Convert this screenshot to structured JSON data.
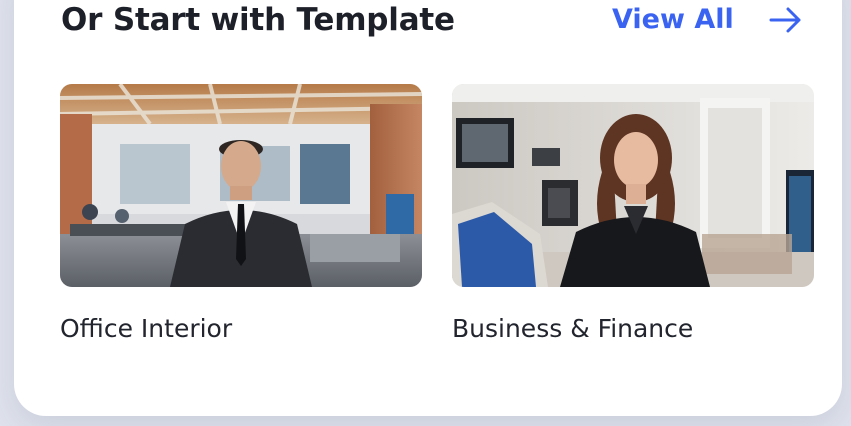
{
  "section": {
    "title": "Or Start with Template",
    "view_all_label": "View All",
    "view_all_icon": "arrow-right-icon"
  },
  "templates": [
    {
      "label": "Office Interior"
    },
    {
      "label": "Business & Finance"
    }
  ],
  "colors": {
    "accent": "#3a63f2",
    "text": "#1d1f29",
    "background": "#dfe2ec",
    "card": "#ffffff"
  }
}
